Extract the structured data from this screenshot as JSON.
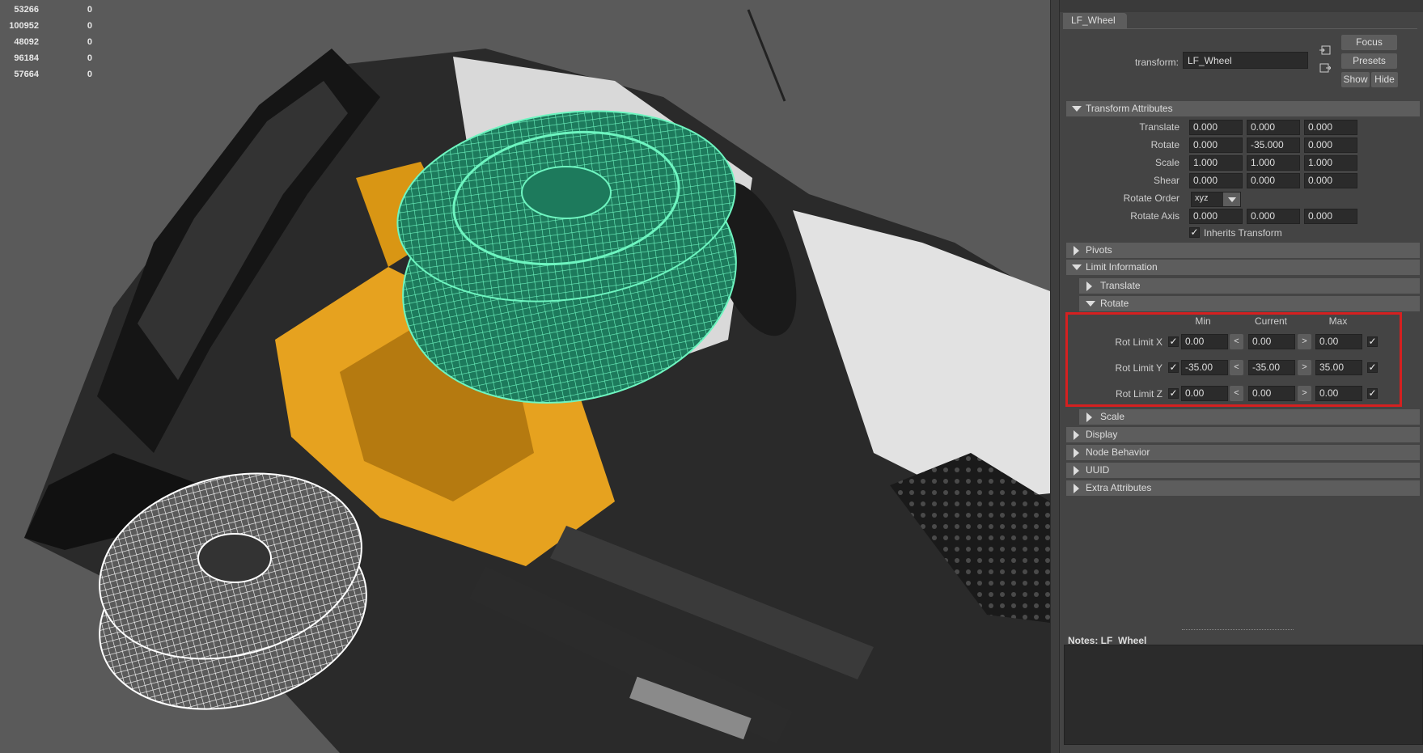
{
  "viewport": {
    "hud_rows": [
      {
        "a": "53266",
        "b": "0"
      },
      {
        "a": "100952",
        "b": "0"
      },
      {
        "a": "48092",
        "b": "0"
      },
      {
        "a": "96184",
        "b": "0"
      },
      {
        "a": "57664",
        "b": "0"
      }
    ]
  },
  "attribute_editor": {
    "node_tab": "LF_Wheel",
    "transform_label": "transform:",
    "transform_value": "LF_Wheel",
    "buttons": {
      "focus": "Focus",
      "presets": "Presets",
      "show": "Show",
      "hide": "Hide"
    },
    "sections": {
      "transform_attributes": "Transform Attributes",
      "pivots": "Pivots",
      "limit_information": "Limit Information",
      "translate": "Translate",
      "rotate": "Rotate",
      "scale": "Scale",
      "display": "Display",
      "node_behavior": "Node Behavior",
      "uuid": "UUID",
      "extra_attributes": "Extra Attributes"
    },
    "transform_rows": [
      {
        "label": "Translate",
        "x": "0.000",
        "y": "0.000",
        "z": "0.000"
      },
      {
        "label": "Rotate",
        "x": "0.000",
        "y": "-35.000",
        "z": "0.000"
      },
      {
        "label": "Scale",
        "x": "1.000",
        "y": "1.000",
        "z": "1.000"
      },
      {
        "label": "Shear",
        "x": "0.000",
        "y": "0.000",
        "z": "0.000"
      }
    ],
    "rotate_order": {
      "label": "Rotate Order",
      "value": "xyz"
    },
    "rotate_axis": {
      "label": "Rotate Axis",
      "x": "0.000",
      "y": "0.000",
      "z": "0.000"
    },
    "inherits_transform": "Inherits Transform",
    "limit_headers": {
      "min": "Min",
      "current": "Current",
      "max": "Max"
    },
    "limit_rows": [
      {
        "label": "Rot Limit X",
        "min": "0.00",
        "current": "0.00",
        "max": "0.00"
      },
      {
        "label": "Rot Limit Y",
        "min": "-35.00",
        "current": "-35.00",
        "max": "35.00"
      },
      {
        "label": "Rot Limit Z",
        "min": "0.00",
        "current": "0.00",
        "max": "0.00"
      }
    ],
    "less_symbol": "<",
    "greater_symbol": ">",
    "notes_label": "Notes:  LF_Wheel"
  }
}
